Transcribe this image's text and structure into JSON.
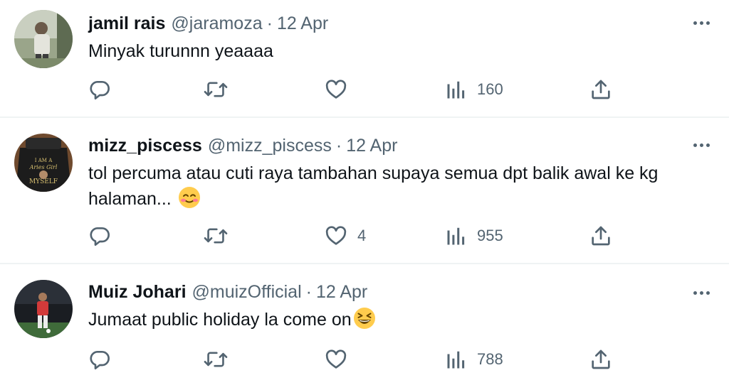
{
  "tweets": [
    {
      "name": "jamil rais",
      "handle": "@jaramoza",
      "separator": "·",
      "date": "12 Apr",
      "text": "Minyak turunnn yeaaaa",
      "emoji": "",
      "actions": {
        "replies": "",
        "retweets": "",
        "likes": "",
        "views": "160"
      }
    },
    {
      "name": "mizz_piscess",
      "handle": "@mizz_piscess",
      "separator": "·",
      "date": "12 Apr",
      "text": "tol percuma atau cuti raya tambahan supaya semua dpt balik awal ke kg halaman...",
      "emoji": "smiling-face-with-hearts-cheeks",
      "actions": {
        "replies": "",
        "retweets": "",
        "likes": "4",
        "views": "955"
      }
    },
    {
      "name": "Muiz Johari",
      "handle": "@muizOfficial",
      "separator": "·",
      "date": "12 Apr",
      "text": "Jumaat public holiday la come on",
      "emoji": "grinning-squinting-face",
      "actions": {
        "replies": "",
        "retweets": "",
        "likes": "",
        "views": "788"
      }
    }
  ],
  "icons": {
    "reply": "reply-icon",
    "retweet": "retweet-icon",
    "like": "heart-icon",
    "views": "views-chart-icon",
    "share": "share-icon",
    "more": "more-options-icon"
  },
  "colors": {
    "text": "#0f1419",
    "secondary": "#536471",
    "divider": "#eff3f4"
  }
}
